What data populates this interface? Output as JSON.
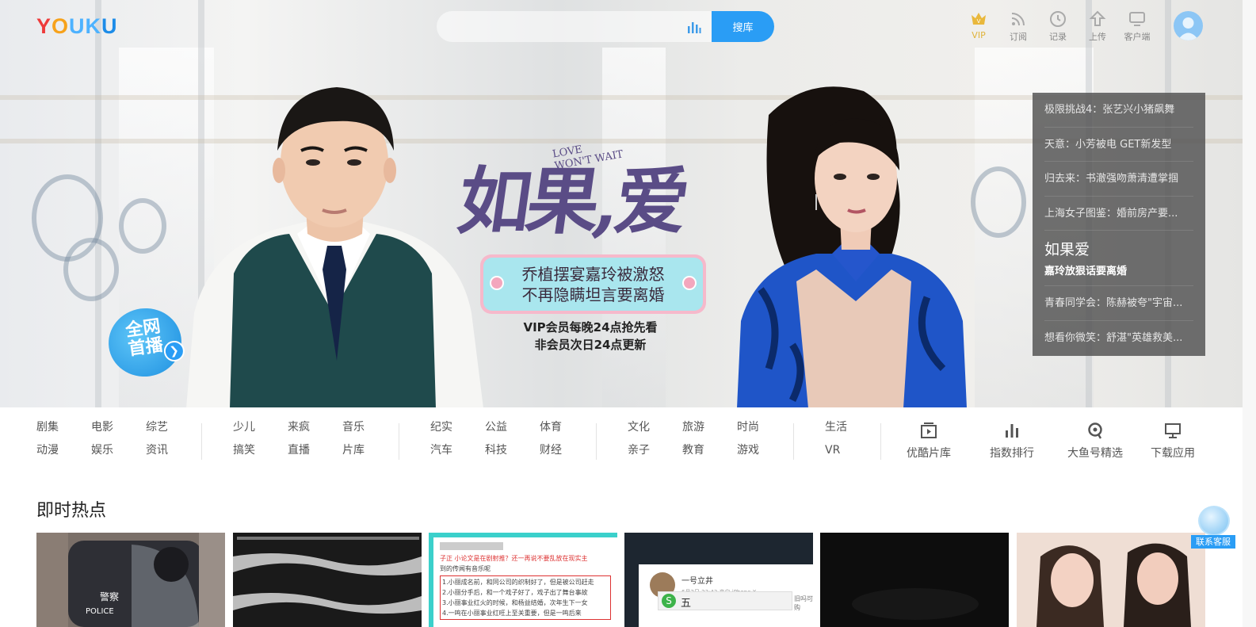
{
  "header": {
    "logo": "YOUKU",
    "search": {
      "placeholder": "",
      "button": "搜库"
    },
    "nav": [
      {
        "label": "VIP",
        "icon": "crown-icon"
      },
      {
        "label": "订阅",
        "icon": "rss-icon"
      },
      {
        "label": "记录",
        "icon": "clock-icon"
      },
      {
        "label": "上传",
        "icon": "upload-icon"
      },
      {
        "label": "客户端",
        "icon": "monitor-icon"
      }
    ]
  },
  "hero": {
    "title_cn": "如果,爱",
    "title_en_1": "LOVE",
    "title_en_2": "WON'T WAIT",
    "headline_1": "乔植摆宴嘉玲被激怒",
    "headline_2": "不再隐瞒坦言要离婚",
    "vip_line_1": "VIP会员每晚24点抢先看",
    "vip_line_2": "非会员次日24点更新",
    "live_badge_1": "全网",
    "live_badge_2": "首播"
  },
  "playlist": [
    {
      "label": "极限挑战4：张艺兴小猪飙舞"
    },
    {
      "label": "天意：小芳被电 GET新发型"
    },
    {
      "label": "归去来：书澈强吻萧清遭掌掴"
    },
    {
      "label": "上海女子图鉴：婚前房产要..."
    },
    {
      "label": "如果爱",
      "sub": "嘉玲放狠话要离婚",
      "active": true
    },
    {
      "label": "青春同学会：陈赫被夸\"宇宙..."
    },
    {
      "label": "想看你微笑：舒湛\"英雄救美..."
    }
  ],
  "categories": [
    [
      "剧集",
      "电影",
      "综艺",
      "动漫",
      "娱乐",
      "资讯"
    ],
    [
      "少儿",
      "来疯",
      "音乐",
      "搞笑",
      "直播",
      "片库"
    ],
    [
      "纪实",
      "公益",
      "体育",
      "汽车",
      "科技",
      "财经"
    ],
    [
      "文化",
      "旅游",
      "时尚",
      "亲子",
      "教育",
      "游戏"
    ],
    [
      "生活",
      "VR"
    ]
  ],
  "tools": [
    {
      "label": "优酷片库",
      "icon": "film-library-icon"
    },
    {
      "label": "指数排行",
      "icon": "bar-chart-icon"
    },
    {
      "label": "大鱼号精选",
      "icon": "fish-icon"
    },
    {
      "label": "下载应用",
      "icon": "desktop-icon"
    }
  ],
  "section": {
    "title": "即时热点"
  },
  "thumbs": [
    {
      "overlay_1": "警察",
      "overlay_2": "POLICE"
    },
    {},
    {
      "t1": "子正 小论文是在剧射推？还一再说不要乱放在现实主",
      "t2": "到的传闻有音乐呢",
      "t3": "1.小丽成名前，和同公司的织制好了，但是被公司赶走",
      "t4": "2.小丽分手后，和一个戏子好了，戏子出了舞台事故",
      "t5": "3.小丽事业红火的时候，和杨益结婚，次年生下一女",
      "t6": "4.一鸣在小丽事业红旺上至关重要，但是一鸣后来"
    },
    {
      "name": "一号立井",
      "meta": "6月2日 23:43 来自 iPhone X",
      "ime": "五",
      "tail": "旧吗可购"
    },
    {},
    {}
  ],
  "customer_service": "联系客服",
  "colors": {
    "brand_blue": "#2a9df5",
    "title_purple": "#5a4c86",
    "playlist_bg": "#505050"
  }
}
